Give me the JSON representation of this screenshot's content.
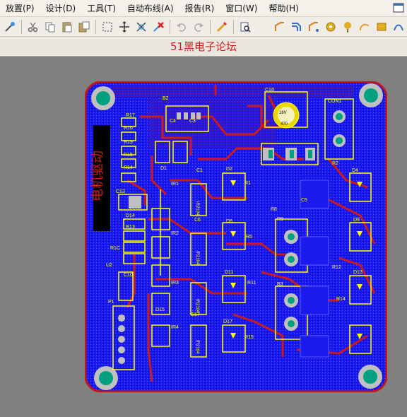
{
  "menu": {
    "items": [
      {
        "id": "place",
        "label": "放置(P)"
      },
      {
        "id": "design",
        "label": "设计(D)"
      },
      {
        "id": "tools",
        "label": "工具(T)"
      },
      {
        "id": "autoroute",
        "label": "自动布线(A)"
      },
      {
        "id": "reports",
        "label": "报告(R)"
      },
      {
        "id": "window",
        "label": "窗口(W)"
      },
      {
        "id": "help",
        "label": "帮助(H)"
      }
    ]
  },
  "toolbar": {
    "left_icons": [
      "wand-icon",
      "scissors-icon",
      "copy-icon",
      "paste-icon",
      "paste-array-icon",
      "select-rect-icon",
      "move-icon",
      "cross-select-icon",
      "deselect-icon",
      "undo-icon",
      "redo-icon",
      "highlight-icon",
      "browse-icon"
    ],
    "right_icons": [
      "route-track-icon",
      "route-multi-icon",
      "interactive-route-icon",
      "pad-icon",
      "via-icon",
      "arc-icon",
      "fill-icon",
      "more-icon"
    ]
  },
  "document": {
    "watermark_title": "51黑电子论坛"
  },
  "pcb": {
    "silk_title": "电机驱动",
    "colors": {
      "board": "#1a1aee",
      "copper_top": "#cc1a1a",
      "silkscreen": "#ffff00",
      "pad": "#c0c0c0",
      "hole": "#00a080",
      "background": "#808080"
    },
    "labels": {
      "b2": "B2",
      "c4": "C4",
      "c3": "C3",
      "c18": "C18",
      "con1": "CON1",
      "c16v": "16V",
      "c470": "470",
      "r17": "R17",
      "r16": "R16",
      "r19": "R19",
      "r15": "R15",
      "r14": "R14",
      "d1": "D1",
      "c1": "C1",
      "c13": "C13",
      "d14": "D14",
      "r13": "R13",
      "r1c": "R1C",
      "d2": "D2",
      "r1": "R1",
      "r2": "R2",
      "d4": "D4",
      "c5": "C5",
      "r8": "R8",
      "c6": "C6",
      "d8": "D8",
      "r5": "R5",
      "r9": "R9",
      "d9": "D9",
      "r12": "R12",
      "d11": "D11",
      "r11": "R11",
      "b3": "B3",
      "d13": "D13",
      "r14b": "R14",
      "d15": "D15",
      "u2": "U2",
      "c10": "C10",
      "p1": "P1",
      "d17": "D17",
      "r15b": "R15",
      "c17": "C17",
      "ir1": "IR1",
      "ir2": "IR2",
      "ir3": "IR3",
      "ir4": "IR4",
      "ic1": "IR2104",
      "ic2": "IR2104",
      "ic3": "IR2104",
      "ic4": "IR2104"
    }
  }
}
